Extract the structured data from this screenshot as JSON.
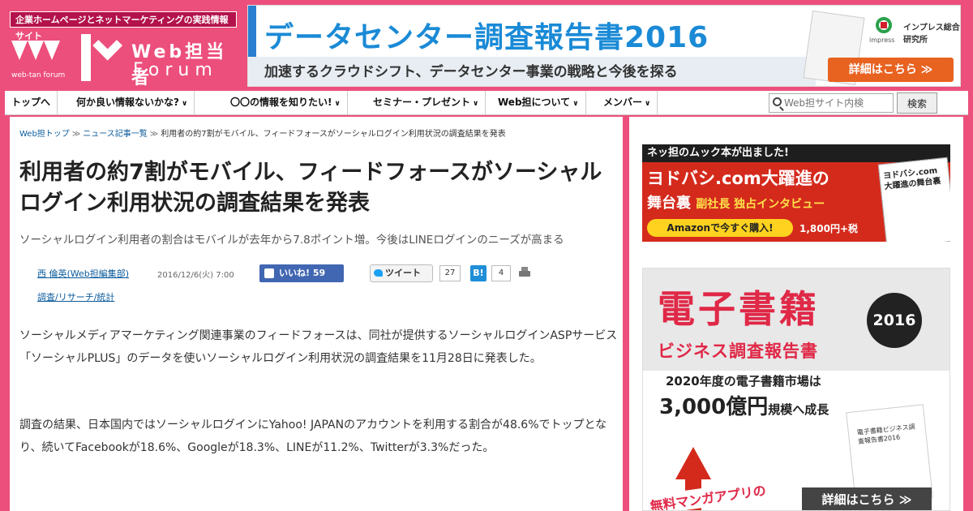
{
  "header": {
    "tagline": "企業ホームページとネットマーケティングの実践情報サイト",
    "logo_caption": "web-tan forum",
    "logo_webtan": "Web担当者",
    "logo_forum": "Forum"
  },
  "banner": {
    "title": "データセンター調査報告書2016",
    "subtitle": "加速するクラウドシフト、データセンター事業の戦略と今後を探る",
    "brand": "インプレス総合研究所",
    "brand_small": "impress",
    "cta": "詳細はこちら ≫"
  },
  "nav": {
    "items": [
      {
        "label": "トップへ",
        "has_arrow": false
      },
      {
        "label": "何か良い情報ないかな?",
        "has_arrow": true
      },
      {
        "label": "〇〇の情報を知りたい!",
        "has_arrow": true
      },
      {
        "label": "セミナー・プレゼント",
        "has_arrow": true
      },
      {
        "label": "Web担について",
        "has_arrow": true
      },
      {
        "label": "メンバー",
        "has_arrow": true
      }
    ],
    "arrow": "∨",
    "search_placeholder": "Web担サイト内検",
    "search_button": "検索"
  },
  "article": {
    "breadcrumb": [
      "Web担トップ",
      "ニュース記事一覧",
      "利用者の約7割がモバイル、フィードフォースがソーシャルログイン利用状況の調査結果を発表"
    ],
    "breadcrumb_sep": "≫",
    "headline": "利用者の約7割がモバイル、フィードフォースがソーシャルログイン利用状況の調査結果を発表",
    "lede": "ソーシャルログイン利用者の割合はモバイルが去年から7.8ポイント増。今後はLINEログインのニーズが高まる",
    "author": "西 倫英(Web担編集部)",
    "date": "2016/12/6(火) 7:00",
    "like_label": "いいね! 59",
    "tweet_label": "ツイート",
    "tweet_count": "27",
    "hatena_label": "B!",
    "hatena_count": "4",
    "category": "調査/リサーチ/統計",
    "paragraphs": [
      "ソーシャルメディアマーケティング関連事業のフィードフォースは、同社が提供するソーシャルログインASPサービス「ソーシャルPLUS」のデータを使いソーシャルログイン利用状況の調査結果を11月28日に発表した。",
      "調査の結果、日本国内ではソーシャルログインにYahoo! JAPANのアカウントを利用する割合が48.6%でトップとなり、続いてFacebookが18.6%、Googleが18.3%、LINEが11.2%、Twitterが3.3%だった。"
    ]
  },
  "sidebar": {
    "ad1": {
      "top": "ネッ担のムック本が出ました!",
      "title": "ヨドバシ.com大躍進の",
      "sub": "舞台裏",
      "sub_small": "副社長 独占インタビュー",
      "button": "Amazonで今すぐ購入!",
      "price": "1,800円+税",
      "book_text": "ヨドバシ.com 大躍進の舞台裏"
    },
    "ad2": {
      "title": "電子書籍",
      "year": "2016",
      "subtitle": "ビジネス調査報告書",
      "line1": "2020年度の電子書籍市場は",
      "line2_big": "3,000億円",
      "line2_small": "規模へ成長",
      "book_text": "電子書籍ビジネス調査報告書2016",
      "manga": "無料マンガアプリの",
      "cta": "詳細はこちら ≫"
    }
  }
}
